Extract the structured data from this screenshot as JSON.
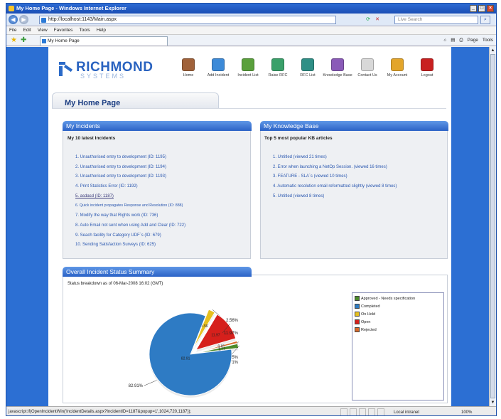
{
  "window": {
    "title": "My Home Page - Windows Internet Explorer",
    "controls": [
      "_",
      "□",
      "×"
    ]
  },
  "address_bar": {
    "url": "http://localhost:1143/Main.aspx",
    "search_placeholder": "Live Search"
  },
  "menu": [
    "File",
    "Edit",
    "View",
    "Favorites",
    "Tools",
    "Help"
  ],
  "tab": {
    "title": "My Home Page"
  },
  "command_bar": {
    "page_label": "Page",
    "tools_label": "Tools"
  },
  "brand": {
    "name": "RICHMOND",
    "sub": "SYSTEMS",
    "color": "#2a63c0"
  },
  "toolbar": [
    {
      "label": "Home",
      "icon": "home-icon",
      "color": "#a0623a"
    },
    {
      "label": "Add Incident",
      "icon": "add-incident-icon",
      "color": "#3c8ad8"
    },
    {
      "label": "Incident List",
      "icon": "incident-list-icon",
      "color": "#5aa03c"
    },
    {
      "label": "Raise RFC",
      "icon": "raise-rfc-icon",
      "color": "#3aa06a"
    },
    {
      "label": "RFC List",
      "icon": "rfc-list-icon",
      "color": "#2f8f86"
    },
    {
      "label": "Knowledge Base",
      "icon": "knowledge-base-icon",
      "color": "#8a5bb8"
    },
    {
      "label": "Contact Us",
      "icon": "contact-us-icon",
      "color": "#d8d8d8"
    },
    {
      "label": "My Account",
      "icon": "my-account-icon",
      "color": "#e3a52a"
    },
    {
      "label": "Logout",
      "icon": "logout-icon",
      "color": "#c82020"
    }
  ],
  "page": {
    "title": "My Home Page"
  },
  "incidents_panel": {
    "title": "My Incidents",
    "subtitle": "My 10 latest Incidents",
    "items": [
      "1. Unauthorised entry to development (ID: 1195)",
      "2. Unauthorised entry to development (ID: 1194)",
      "3. Unauthorised entry to development (ID: 1193)",
      "4. Print Statistics Error (ID: 1192)",
      "5. asdasd (ID: 1187)",
      "6. Quick incident propagates Response and Resolution (ID: 888)",
      "7. Modify the way that Rights work (ID: 736)",
      "8. Auto Email not sent when using Add and Clear (ID: 722)",
      "9. Seach facility for Category UDF`s (ID: 679)",
      "10. Sending Satisfaction Surveys (ID: 625)"
    ]
  },
  "kb_panel": {
    "title": "My Knowledge Base",
    "subtitle": "Top 5 most popular KB articles",
    "items": [
      "1. Untitled (viewed 21 times)",
      "2. Error when launching a NetOp Session. (viewed 16 times)",
      "3. FEATURE - SLA`s (viewed 10 times)",
      "4. Automatic resolution email reformatted slightly (viewed 8 times)",
      "5. Untitled (viewed 8 times)"
    ]
  },
  "summary_panel": {
    "title": "Overall Incident Status Summary",
    "subtitle": "Status breakdown as of 06-Mar-2008 16:02 (GMT)"
  },
  "chart_data": {
    "type": "pie",
    "title": "",
    "slices": [
      {
        "name": "Completed",
        "value": 82.91,
        "label": "82.91%",
        "inner_label": "82.91",
        "color": "#2e7bc4"
      },
      {
        "name": "On Hold",
        "value": 2.56,
        "label": "2.56%",
        "inner_label": "2.56",
        "color": "#e6c020"
      },
      {
        "name": "Open",
        "value": 11.97,
        "label": "11.97%",
        "inner_label": "11.97",
        "color": "#d6201c"
      },
      {
        "name": "Rejected",
        "value": 0.85,
        "label": "0.85%",
        "inner_label": "0.85",
        "color": "#d86a2a"
      },
      {
        "name": "Approved - Needs specification",
        "value": 1.71,
        "label": "1.71%",
        "inner_label": "1.71",
        "color": "#4c8a2a"
      }
    ],
    "legend": [
      {
        "name": "Approved - Needs specification",
        "color": "#4c8a2a"
      },
      {
        "name": "Completed",
        "color": "#2e7bc4"
      },
      {
        "name": "On Hold",
        "color": "#e6c020"
      },
      {
        "name": "Open",
        "color": "#d6201c"
      },
      {
        "name": "Rejected",
        "color": "#d86a2a"
      }
    ],
    "legend_position": "right"
  },
  "status_bar": {
    "text": "javascript:if(OpenIncidentWin('IncidentDetails.aspx?IncidentID=1187&popup=1',1024,720,1187));",
    "zone": "Local intranet",
    "zoom": "100%"
  }
}
